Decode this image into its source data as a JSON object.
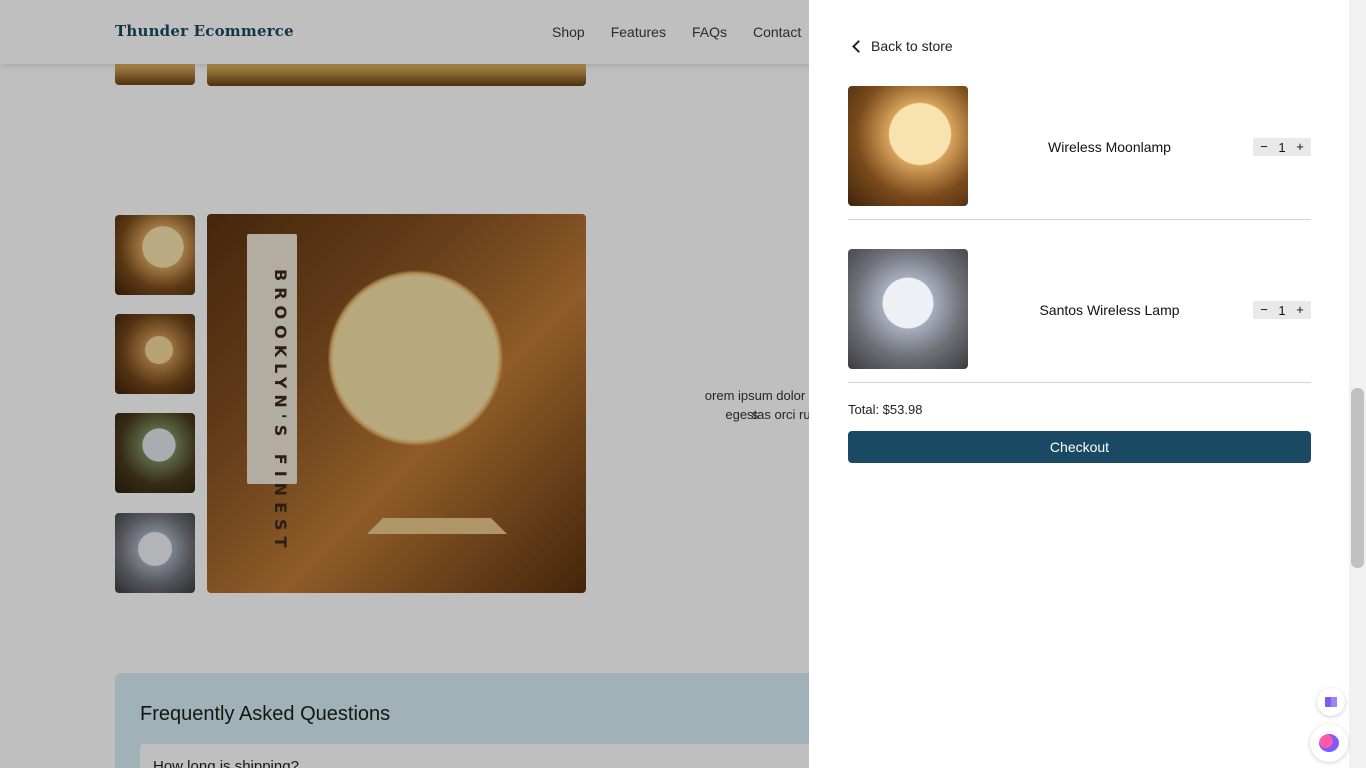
{
  "store": {
    "brand": "Thunder Ecommerce",
    "nav": [
      "Shop",
      "Features",
      "FAQs",
      "Contact"
    ],
    "lorem_line1": "orem ipsum dolor s",
    "lorem_line2": "egestas orci ru",
    "book_label": "BROOKLYN'S FINEST",
    "faq_title": "Frequently Asked Questions",
    "faq_question": "How long is shipping?"
  },
  "cart": {
    "back_label": "Back to store",
    "items": [
      {
        "name": "Wireless Moonlamp",
        "quantity": "1",
        "minus": "−",
        "plus": "+"
      },
      {
        "name": "Santos Wireless Lamp",
        "quantity": "1",
        "minus": "−",
        "plus": "+"
      }
    ],
    "total_label": "Total: $53.98",
    "checkout_label": "Checkout"
  },
  "colors": {
    "brand": "#1a4a63",
    "checkout_bg": "#1a4a63",
    "faq_bg": "#d6ecf6"
  },
  "icons": {
    "back": "chevron-left-icon",
    "widget_top": "book-icon",
    "widget_bottom": "brain-icon"
  }
}
